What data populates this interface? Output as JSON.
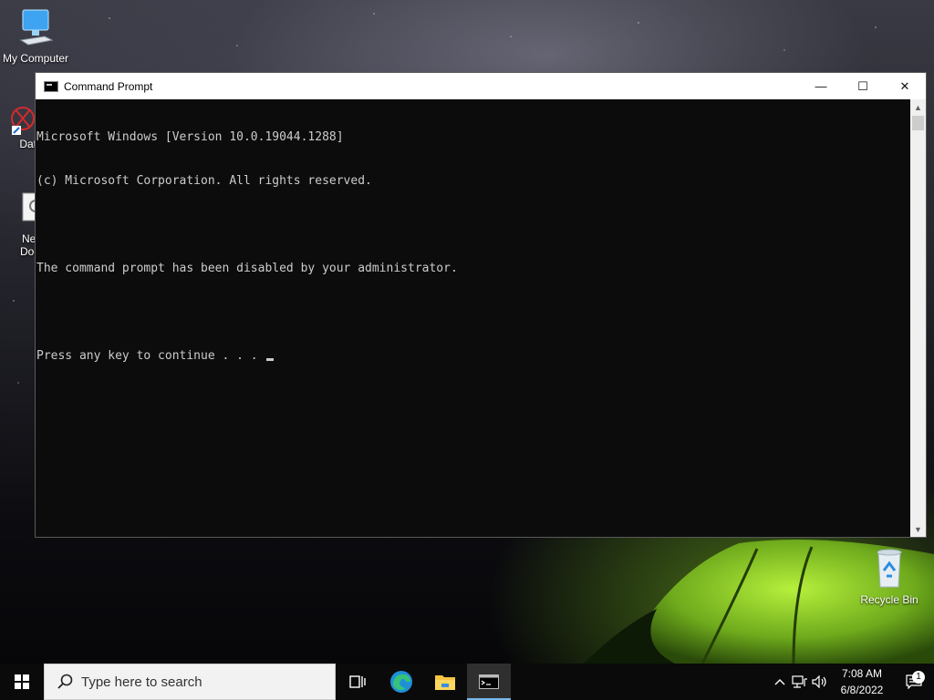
{
  "desktop": {
    "icons": [
      {
        "label": "My Computer"
      },
      {
        "label": "DataW"
      },
      {
        "label": "New\nDocu"
      },
      {
        "label": "Recycle Bin"
      }
    ]
  },
  "window": {
    "title": "Command Prompt",
    "console_lines": [
      "Microsoft Windows [Version 10.0.19044.1288]",
      "(c) Microsoft Corporation. All rights reserved.",
      "",
      "The command prompt has been disabled by your administrator.",
      "",
      "Press any key to continue . . . "
    ],
    "controls": {
      "minimize": "—",
      "maximize": "☐",
      "close": "✕"
    }
  },
  "taskbar": {
    "search_placeholder": "Type here to search",
    "apps": [
      {
        "icon": "task-view-icon"
      },
      {
        "icon": "edge-icon"
      },
      {
        "icon": "file-explorer-icon"
      },
      {
        "icon": "command-prompt-icon",
        "active": true
      }
    ],
    "tray": {
      "time": "7:08 AM",
      "date": "6/8/2022",
      "notification_count": "1"
    }
  },
  "colors": {
    "console_bg": "#0c0c0c",
    "console_text": "#cccccc",
    "taskbar_bg": "#0a0a0a",
    "accent": "#76b9ed"
  }
}
